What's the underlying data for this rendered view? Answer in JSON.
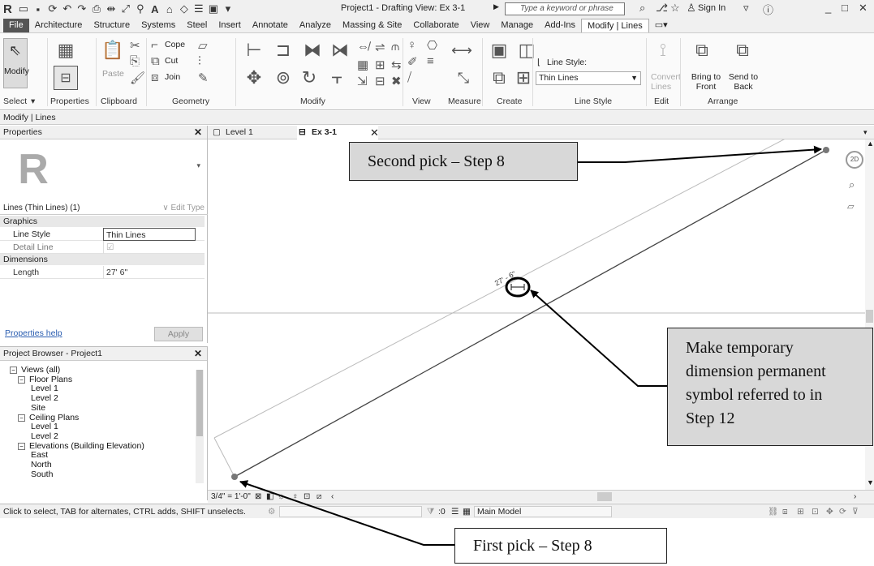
{
  "titlebar": {
    "app_logo": "R",
    "document_title": "Project1 - Drafting View: Ex 3-1",
    "search_placeholder": "Type a keyword or phrase",
    "signin_label": "Sign In"
  },
  "tabs": [
    "File",
    "Architecture",
    "Structure",
    "Systems",
    "Steel",
    "Insert",
    "Annotate",
    "Analyze",
    "Massing & Site",
    "Collaborate",
    "View",
    "Manage",
    "Add-Ins",
    "Modify | Lines"
  ],
  "ribbon": {
    "modify_label": "Modify",
    "paste_label": "Paste",
    "cope_label": "Cope",
    "cut_label": "Cut",
    "join_label": "Join",
    "line_style_caption": "Line Style:",
    "line_style_value": "Thin Lines",
    "convert_lines_label": "Convert Lines",
    "bring_to_front_label": "Bring to Front",
    "send_to_back_label": "Send to Back",
    "panels": {
      "select": "Select",
      "properties": "Properties",
      "clipboard": "Clipboard",
      "geometry": "Geometry",
      "modify": "Modify",
      "view": "View",
      "measure": "Measure",
      "create": "Create",
      "line_style": "Line Style",
      "edit": "Edit",
      "arrange": "Arrange"
    }
  },
  "context_bar": "Modify | Lines",
  "properties": {
    "title": "Properties",
    "type_selector": "Lines (Thin Lines) (1)",
    "edit_type": "Edit Type",
    "group_graphics": "Graphics",
    "line_style_name": "Line Style",
    "line_style_value": "Thin Lines",
    "detail_line_name": "Detail Line",
    "detail_line_checked": true,
    "group_dimensions": "Dimensions",
    "length_name": "Length",
    "length_value": "27' 6\"",
    "help_link": "Properties help",
    "apply_button": "Apply"
  },
  "project_browser": {
    "title": "Project Browser - Project1",
    "items": [
      {
        "label": "Views (all)",
        "level": 0,
        "toggle": "-"
      },
      {
        "label": "Floor Plans",
        "level": 1,
        "toggle": "-"
      },
      {
        "label": "Level 1",
        "level": 2
      },
      {
        "label": "Level 2",
        "level": 2
      },
      {
        "label": "Site",
        "level": 2
      },
      {
        "label": "Ceiling Plans",
        "level": 1,
        "toggle": "-"
      },
      {
        "label": "Level 1",
        "level": 2
      },
      {
        "label": "Level 2",
        "level": 2
      },
      {
        "label": "Elevations (Building Elevation)",
        "level": 1,
        "toggle": "-"
      },
      {
        "label": "East",
        "level": 2
      },
      {
        "label": "North",
        "level": 2
      },
      {
        "label": "South",
        "level": 2
      }
    ]
  },
  "view_tabs": [
    {
      "label": "Level 1",
      "active": false
    },
    {
      "label": "Ex 3-1",
      "active": true
    }
  ],
  "drawing": {
    "dimension_text": "27' - 6\""
  },
  "view_control": {
    "scale": "3/4\" = 1'-0\""
  },
  "status_bar": {
    "hint": "Click to select, TAB for alternates, CTRL adds, SHIFT unselects.",
    "selection_count": ":0",
    "model": "Main Model"
  },
  "callouts": {
    "second_pick": "Second pick – Step 8",
    "first_pick": "First pick – Step 8",
    "temp_dim": [
      "Make temporary",
      "dimension permanent",
      "symbol referred to in",
      "Step 12"
    ]
  },
  "colors": {
    "ribbon_bg": "#fafafa",
    "callout_bg": "#d8d8d8",
    "link": "#2a5db0"
  }
}
